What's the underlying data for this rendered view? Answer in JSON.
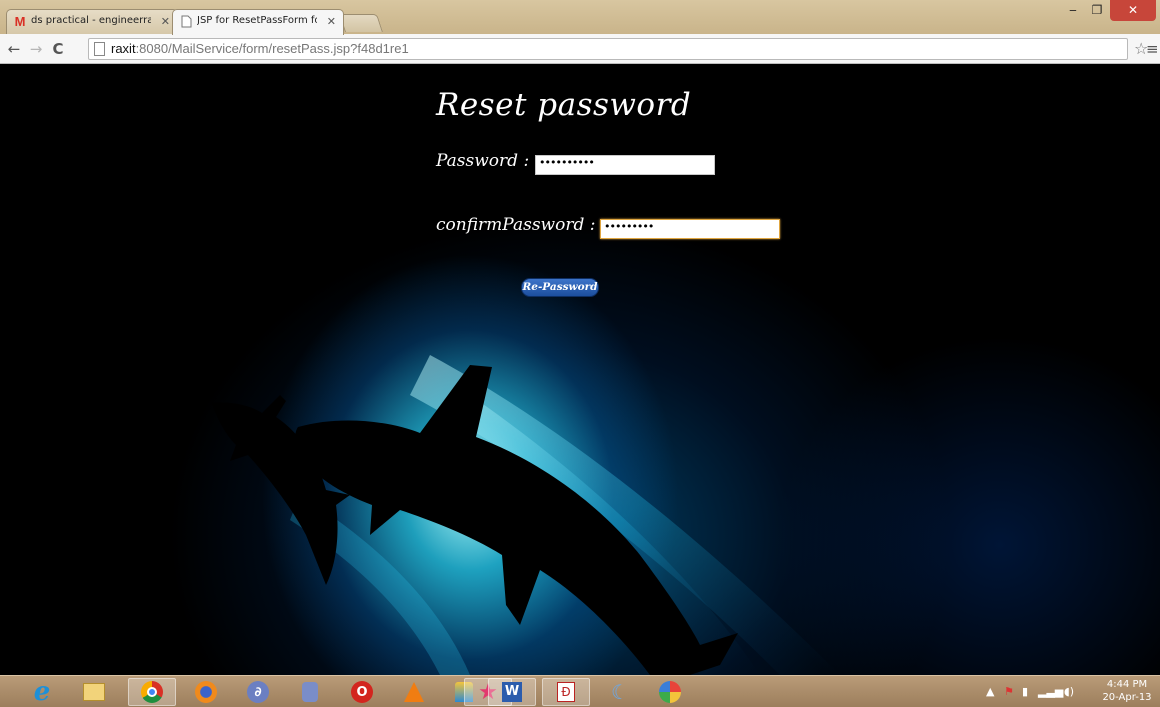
{
  "browser": {
    "tabs": [
      {
        "label": "ds practical - engineerraxit",
        "icon": "gmail-icon",
        "active": false
      },
      {
        "label": "JSP for ResetPassForm form",
        "icon": "page-icon",
        "active": true
      }
    ],
    "address_host": "raxit",
    "address_rest": ":8080/MailService/form/resetPass.jsp?f48d1re1"
  },
  "page": {
    "title": "Reset password",
    "password_label": "Password :",
    "password_value": "••••••••••",
    "confirm_label": "confirmPassword :",
    "confirm_value": "•••••••••",
    "submit_label": "Re-Password"
  },
  "taskbar": {
    "apps": [
      "internet-explorer-icon",
      "file-explorer-icon",
      "chrome-icon",
      "firefox-icon",
      "eclipse-icon",
      "database-icon",
      "opera-icon",
      "vlc-icon",
      "app-icon",
      "bookmark-star-icon",
      "word-icon",
      "pdf-icon",
      "dolphin-icon",
      "paint-icon"
    ],
    "time": "4:44 PM",
    "date": "20-Apr-13"
  }
}
